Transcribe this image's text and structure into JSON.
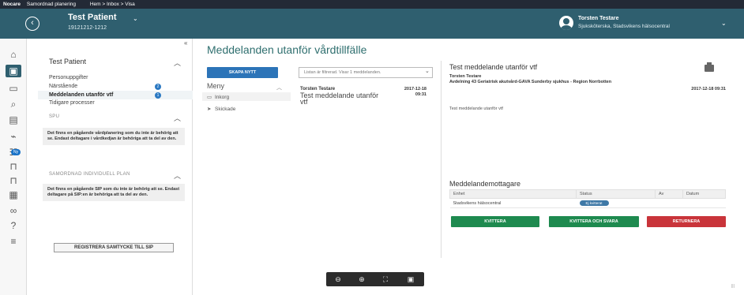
{
  "topbar": {
    "brand": "Nocare",
    "app_name": "Samordnad planering",
    "breadcrumb": "Hem > Inbox > Visa"
  },
  "patient": {
    "name": "Test Patient",
    "id": "19121212-1212"
  },
  "user": {
    "name": "Torsten Testare",
    "role": "Sjuksköterska, Stadsvikens hälsocentral"
  },
  "rail": {
    "badge": "Ny",
    "icons": [
      "home-icon",
      "patient-icon",
      "inbox-icon",
      "search-icon",
      "document-icon",
      "chart-icon",
      "people-icon",
      "bed-icon",
      "bed-icon-2",
      "calendar-icon",
      "link-icon",
      "help-icon",
      "settings-icon"
    ]
  },
  "left_panel": {
    "collapse": "«",
    "title": "Test Patient",
    "items": [
      {
        "label": "Personuppgifter"
      },
      {
        "label": "Närstående",
        "badge": "2"
      },
      {
        "label": "Meddelanden utanför vtf",
        "badge": "1"
      },
      {
        "label": "Tidigare processer"
      }
    ],
    "section_spu": "SPU",
    "spu_info": "Det finns en pågående vårdplanering som du inte är behörig att se. Endast deltagare i vårdkedjan är behöriga att ta del av den.",
    "section_sip": "SAMORDNAD INDIVIDUELL PLAN",
    "sip_info": "Det finns en pågående SIP som du inte är behörig att se. Endast deltagare på SIP:en är behöriga att ta del av den.",
    "register_button": "REGISTRERA SAMTYCKE TILL SIP"
  },
  "main": {
    "title": "Meddelanden utanför vårdtillfälle",
    "new_button": "SKAPA NYTT",
    "menu_header": "Meny",
    "menu_items": [
      {
        "label": "Inkorg"
      },
      {
        "label": "Skickade"
      }
    ],
    "filter_text": "Listan är filtrerad. Visar 1 meddelanden."
  },
  "message_list": [
    {
      "sender": "Torsten Testare",
      "date": "2017-12-18",
      "time": "09:31",
      "subject": "Test meddelande utanför vtf"
    }
  ],
  "detail": {
    "title": "Test meddelande utanför vtf",
    "sender": "Torsten Testare",
    "unit": "Avdelning 43 Geriatrisk akutvård-GAVA Sunderby sjukhus - Region Norrbotten",
    "datetime": "2017-12-18 09:31",
    "body": "Test meddelande utanför vtf",
    "recipients_title": "Meddelandemottagare",
    "columns": [
      "Enhet",
      "Status",
      "Av",
      "Datum"
    ],
    "recipients": [
      {
        "unit": "Stadsvikens hälsocentral",
        "status": "Ej kvitterat",
        "by": "",
        "date": ""
      }
    ],
    "btn_kvittera": "KVITTERA",
    "btn_kvittera_svara": "KVITTERA OCH SVARA",
    "btn_returnera": "RETURNERA"
  },
  "zoombar": {
    "icons": [
      "zoom-out-icon",
      "zoom-in-icon",
      "fit-screen-icon",
      "fullscreen-icon"
    ]
  },
  "corner": "|||"
}
